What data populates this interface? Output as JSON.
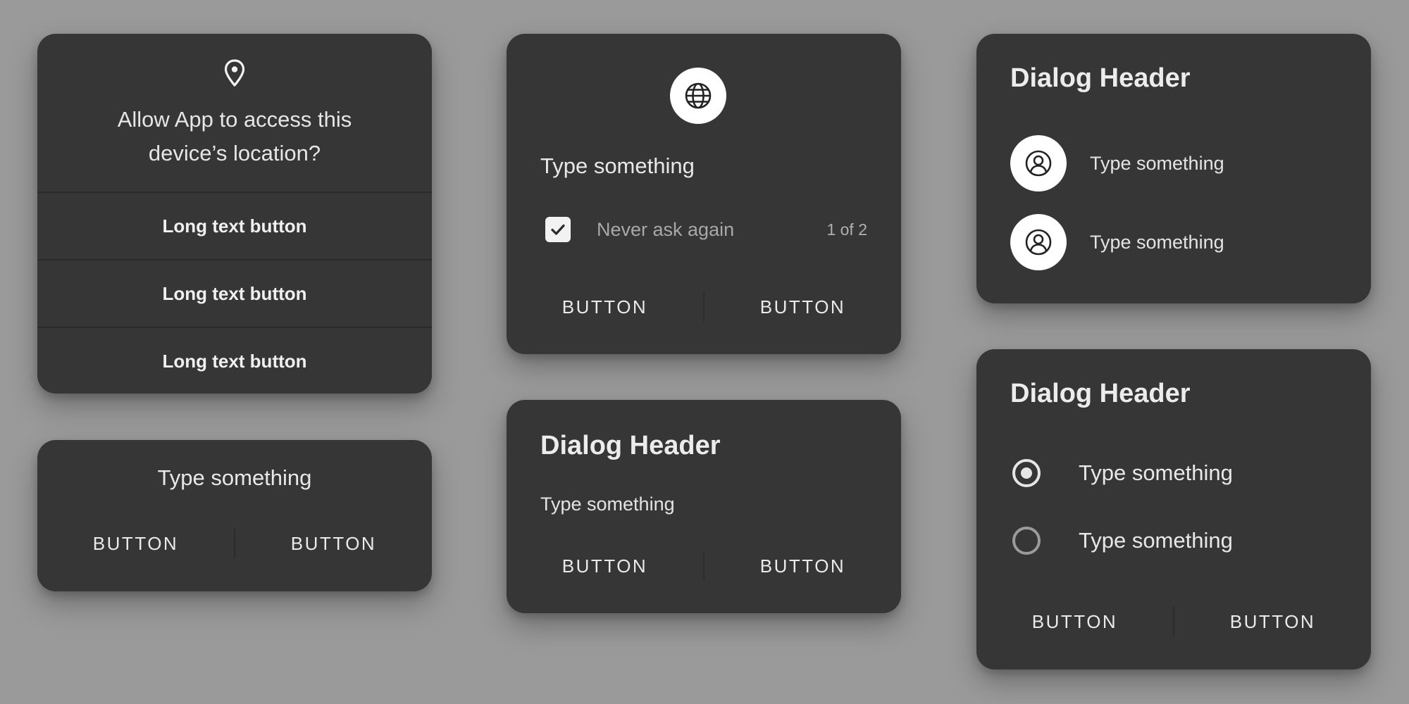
{
  "colors": {
    "background": "#9a9a9a",
    "card": "#363636",
    "text": "#e8e8e8",
    "icon_bg": "#ffffff"
  },
  "location_dialog": {
    "icon": "location-pin-icon",
    "title": "Allow App to access this device’s location?",
    "buttons": [
      {
        "label": "Long text button"
      },
      {
        "label": "Long text button"
      },
      {
        "label": "Long text button"
      }
    ]
  },
  "simple_dialog": {
    "text": "Type something",
    "buttons": [
      {
        "label": "BUTTON"
      },
      {
        "label": "BUTTON"
      }
    ]
  },
  "globe_dialog": {
    "icon": "globe-icon",
    "text": "Type something",
    "checkbox": {
      "label": "Never ask again",
      "checked": true
    },
    "pager": "1 of 2",
    "buttons": [
      {
        "label": "BUTTON"
      },
      {
        "label": "BUTTON"
      }
    ]
  },
  "header_text_dialog": {
    "header": "Dialog Header",
    "text": "Type something",
    "buttons": [
      {
        "label": "BUTTON"
      },
      {
        "label": "BUTTON"
      }
    ]
  },
  "users_dialog": {
    "header": "Dialog Header",
    "items": [
      {
        "icon": "user-icon",
        "label": "Type something"
      },
      {
        "icon": "user-icon",
        "label": "Type something"
      }
    ]
  },
  "radio_dialog": {
    "header": "Dialog Header",
    "options": [
      {
        "label": "Type something",
        "selected": true
      },
      {
        "label": "Type something",
        "selected": false
      }
    ],
    "buttons": [
      {
        "label": "BUTTON"
      },
      {
        "label": "BUTTON"
      }
    ]
  }
}
